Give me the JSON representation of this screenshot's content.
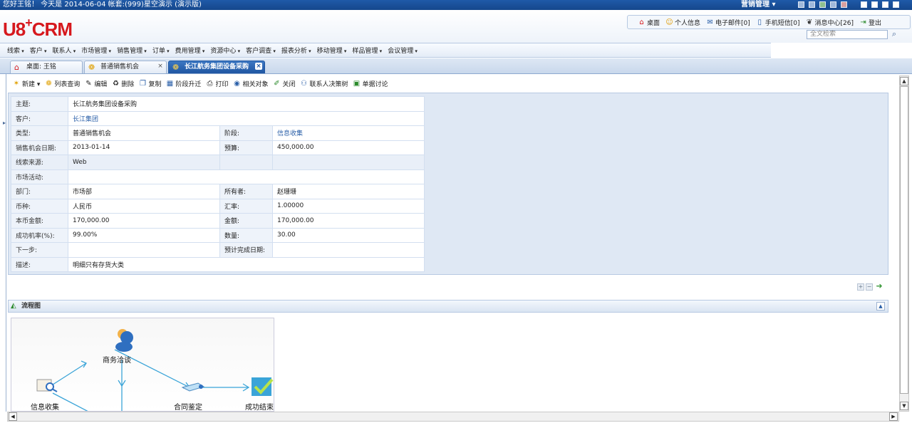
{
  "topbar": {
    "greeting": "您好王铭！ 今天是 2014-06-04 帐套:(999)星空演示 (演示版)",
    "module": "营销管理 ▾"
  },
  "header": {
    "logo": "U8",
    "logo_plus": "+",
    "logo_suffix": "CRM",
    "links": [
      {
        "label": "桌面",
        "icon": "home-icon"
      },
      {
        "label": "个人信息",
        "icon": "user-icon"
      },
      {
        "label": "电子邮件[0]",
        "icon": "mail-icon"
      },
      {
        "label": "手机短信[0]",
        "icon": "phone-icon"
      },
      {
        "label": "消息中心[26]",
        "icon": "message-icon"
      },
      {
        "label": "登出",
        "icon": "logout-icon"
      }
    ],
    "search_placeholder": "全文检索"
  },
  "menu": [
    "线索",
    "客户",
    "联系人",
    "市场管理",
    "销售管理",
    "订单",
    "费用管理",
    "资源中心",
    "客户调查",
    "报表分析",
    "移动管理",
    "样品管理",
    "会议管理"
  ],
  "tabs": [
    {
      "label": "桌面: 王铭",
      "icon": "home-icon"
    },
    {
      "label": "普通销售机会",
      "icon": "opportunity-icon"
    },
    {
      "label": "长江航务集团设备采购",
      "icon": "opportunity-icon"
    }
  ],
  "toolbar": [
    "新建 ▾",
    "列表查询",
    "编辑",
    "删除",
    "复制",
    "阶段升迁",
    "打印",
    "相关对象",
    "关闭",
    "联系人决策树",
    "单据讨论"
  ],
  "form": {
    "subject_label": "主题:",
    "subject": "长江航务集团设备采购",
    "customer_label": "客户:",
    "customer": "长江集团",
    "type_label": "类型:",
    "type": "普通销售机会",
    "stage_label": "阶段:",
    "stage": "信息收集",
    "date_label": "销售机会日期:",
    "date": "2013-01-14",
    "budget_label": "预算:",
    "budget": "450,000.00",
    "source_label": "线索来源:",
    "source": "Web",
    "campaign_label": "市场活动:",
    "dept_label": "部门:",
    "dept": "市场部",
    "owner_label": "所有者:",
    "owner": "赵珊珊",
    "currency_label": "币种:",
    "currency": "人民币",
    "rate_label": "汇率:",
    "rate": "1.00000",
    "local_amount_label": "本币金额:",
    "local_amount": "170,000.00",
    "amount_label": "金额:",
    "amount": "170,000.00",
    "prob_label": "成功机率(%):",
    "prob": "99.00%",
    "qty_label": "数量:",
    "qty": "30.00",
    "next_label": "下一步:",
    "due_label": "预计完成日期:",
    "desc_label": "描述:",
    "desc": "明细只有存货大类"
  },
  "flow": {
    "title": "流程图",
    "nodes": [
      "商务洽谈",
      "信息收集",
      "合同鉴定",
      "成功结束"
    ]
  }
}
